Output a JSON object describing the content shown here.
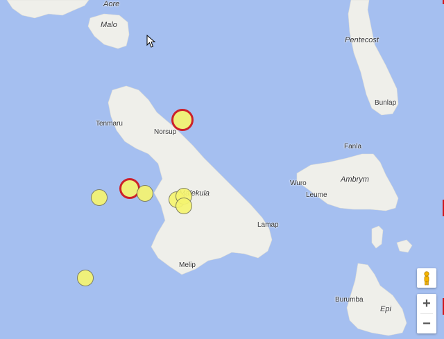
{
  "map": {
    "water_color": "#a5bff0",
    "land_color": "#efefea",
    "labels": [
      {
        "text": "Aore",
        "style": "big"
      },
      {
        "text": "Malo",
        "style": "big"
      },
      {
        "text": "Pentecost",
        "style": "big"
      },
      {
        "text": "Bunlap",
        "style": "normal"
      },
      {
        "text": "Tenmaru",
        "style": "normal"
      },
      {
        "text": "Norsup",
        "style": "normal"
      },
      {
        "text": "Fanla",
        "style": "normal"
      },
      {
        "text": "Malekula",
        "style": "big"
      },
      {
        "text": "Ambrym",
        "style": "big"
      },
      {
        "text": "Wuro",
        "style": "normal"
      },
      {
        "text": "Leume",
        "style": "normal"
      },
      {
        "text": "Lamap",
        "style": "normal"
      },
      {
        "text": "Melip",
        "style": "normal"
      },
      {
        "text": "Burumba",
        "style": "normal"
      },
      {
        "text": "Epi",
        "style": "big"
      }
    ],
    "markers": [
      {
        "type": "highlight",
        "color": "#f6f570",
        "border_color": "#d0141a"
      },
      {
        "type": "highlight",
        "color": "#f6f570",
        "border_color": "#d0141a"
      },
      {
        "type": "normal",
        "color": "#f6f570"
      },
      {
        "type": "normal",
        "color": "#f6f570"
      },
      {
        "type": "normal",
        "color": "#f6f570"
      },
      {
        "type": "normal",
        "color": "#f6f570"
      },
      {
        "type": "normal",
        "color": "#f6f570"
      },
      {
        "type": "normal",
        "color": "#f6f570"
      }
    ]
  },
  "controls": {
    "pegman_icon": "pegman-icon",
    "zoom_in_label": "+",
    "zoom_out_label": "−"
  }
}
